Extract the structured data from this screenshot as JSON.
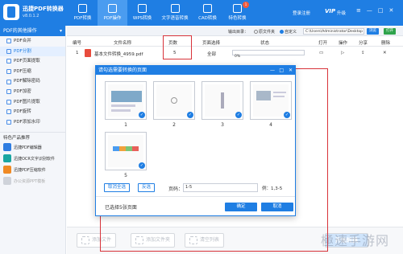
{
  "app": {
    "name": "迅捷PDF转换器",
    "version": "v8.0.1.2"
  },
  "topnav": [
    {
      "label": "PDF转换",
      "active": false,
      "badge": ""
    },
    {
      "label": "PDF操作",
      "active": true,
      "badge": ""
    },
    {
      "label": "WPS转换",
      "active": false,
      "badge": ""
    },
    {
      "label": "文字语音转换",
      "active": false,
      "badge": ""
    },
    {
      "label": "CAD转换",
      "active": false,
      "badge": ""
    },
    {
      "label": "特色转换",
      "active": false,
      "badge": "1"
    }
  ],
  "account": {
    "login": "登录注册",
    "vip": "VIP",
    "vip_label": "升级"
  },
  "window_controls": [
    "≡",
    "—",
    "□",
    "✕"
  ],
  "sidebar": {
    "header": "PDF的其他操作",
    "items": [
      {
        "label": "PDF合并",
        "active": false
      },
      {
        "label": "PDF分割",
        "active": true
      },
      {
        "label": "PDF页面提取",
        "active": false
      },
      {
        "label": "PDF压缩",
        "active": false
      },
      {
        "label": "PDF解除密码",
        "active": false
      },
      {
        "label": "PDF加密",
        "active": false
      },
      {
        "label": "PDF图片提取",
        "active": false
      },
      {
        "label": "PDF旋转",
        "active": false
      },
      {
        "label": "PDF添加水印",
        "active": false
      }
    ],
    "recommend_title": "特色产品推荐",
    "apps": [
      {
        "label": "迅捷PDF编辑器",
        "color": "#2f7de1",
        "dim": false
      },
      {
        "label": "迅捷OCR文字识别软件",
        "color": "#1aa6a1",
        "dim": false
      },
      {
        "label": "迅捷PDF压缩软件",
        "color": "#f08a24",
        "dim": false
      },
      {
        "label": "办公资源PPT模板",
        "color": "#cfd3da",
        "dim": true
      }
    ]
  },
  "toolbar": {
    "output_dir_label": "输出目录：",
    "original_folder": "原文件夹",
    "custom": "自定义",
    "path": "C:\\Users\\Administrator\\Desktop",
    "browse": "浏览",
    "open": "打开"
  },
  "table": {
    "headers": [
      "编号",
      "文件名称",
      "页数",
      "页面选择",
      "状态",
      "打开",
      "操作",
      "分享",
      "删除"
    ],
    "rows": [
      {
        "index": "1",
        "name": "基本文件转换_4959.pdf",
        "pages": "5",
        "selection": "全部",
        "progress_label": "0%",
        "progress": 0
      }
    ]
  },
  "bottom": {
    "add_file": "添加文件",
    "add_folder": "添加文件夹",
    "clear_list": "清空列表",
    "start": "开始转换"
  },
  "dialog": {
    "title": "请勾选需要转换的页面",
    "controls": [
      "—",
      "□",
      "✕"
    ],
    "thumbnails": [
      {
        "label": "1",
        "checked": true
      },
      {
        "label": "2",
        "checked": true
      },
      {
        "label": "3",
        "checked": true
      },
      {
        "label": "4",
        "checked": true
      },
      {
        "label": "5",
        "checked": true
      }
    ],
    "deselect_all": "取消全选",
    "invert": "反选",
    "page_label": "页码：",
    "page_input": "1-5",
    "example": "例：1,3-5",
    "selected_text": "已选择5张页面",
    "ok": "确定",
    "cancel": "取消"
  },
  "watermark": "極速手游网",
  "colors": {
    "accent": "#1f7ee3",
    "annotation": "#d8333a"
  }
}
